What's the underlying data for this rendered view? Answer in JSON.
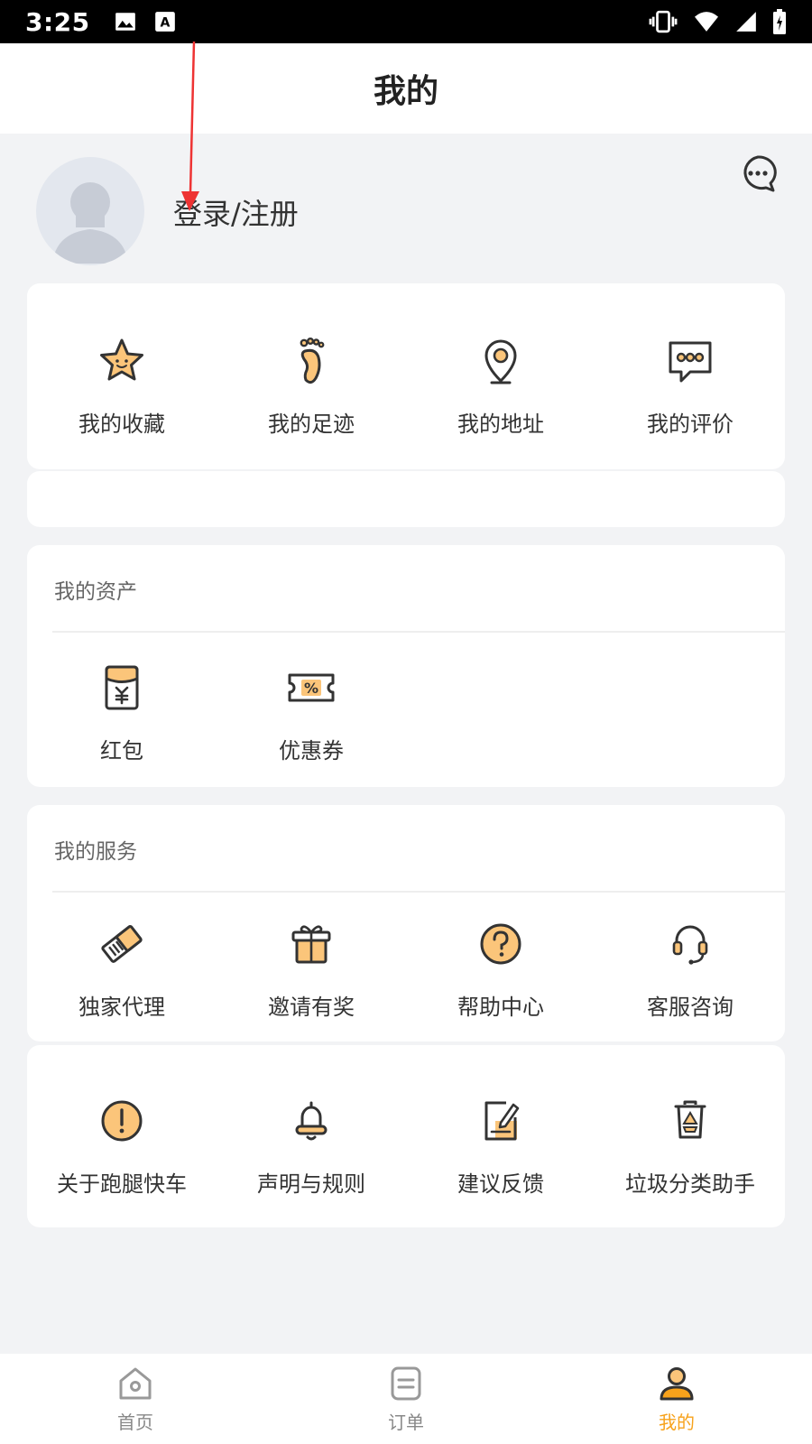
{
  "status_bar": {
    "time": "3:25",
    "left_icons": [
      "image-icon",
      "text-a-icon"
    ],
    "right_icons": [
      "vibrate-icon",
      "wifi-icon",
      "signal-icon",
      "battery-icon"
    ]
  },
  "header": {
    "title": "我的"
  },
  "profile": {
    "login_label": "登录/注册",
    "avatar_icon": "avatar-placeholder-icon",
    "message_icon": "chat-bubble-icon"
  },
  "quick_actions": [
    {
      "label": "我的收藏",
      "icon": "star-icon"
    },
    {
      "label": "我的足迹",
      "icon": "footprint-icon"
    },
    {
      "label": "我的地址",
      "icon": "location-pin-icon"
    },
    {
      "label": "我的评价",
      "icon": "comment-icon"
    }
  ],
  "assets": {
    "title": "我的资产",
    "items": [
      {
        "label": "红包",
        "icon": "red-envelope-icon"
      },
      {
        "label": "优惠券",
        "icon": "coupon-icon"
      }
    ]
  },
  "services": {
    "title": "我的服务",
    "items": [
      {
        "label": "独家代理",
        "icon": "handshake-icon"
      },
      {
        "label": "邀请有奖",
        "icon": "gift-icon"
      },
      {
        "label": "帮助中心",
        "icon": "help-icon"
      },
      {
        "label": "客服咨询",
        "icon": "headset-icon"
      }
    ]
  },
  "more": {
    "items": [
      {
        "label": "关于跑腿快车",
        "icon": "info-icon"
      },
      {
        "label": "声明与规则",
        "icon": "bell-icon"
      },
      {
        "label": "建议反馈",
        "icon": "feedback-icon"
      },
      {
        "label": "垃圾分类助手",
        "icon": "recycle-bin-icon"
      }
    ]
  },
  "tabbar": {
    "tabs": [
      {
        "label": "首页",
        "icon": "home-icon",
        "active": false
      },
      {
        "label": "订单",
        "icon": "order-icon",
        "active": false
      },
      {
        "label": "我的",
        "icon": "user-icon",
        "active": true
      }
    ]
  },
  "colors": {
    "accent": "#f7a21b",
    "icon_fill": "#fbc57a",
    "icon_stroke": "#333333",
    "background": "#f2f3f5",
    "annotation_arrow": "#ee3333"
  }
}
